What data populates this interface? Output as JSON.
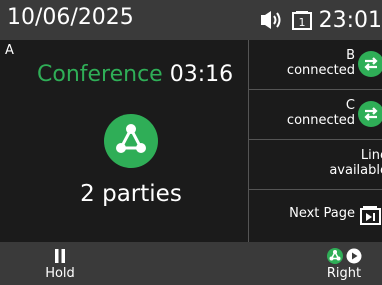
{
  "status_bar": {
    "date": "10/06/2025",
    "time": "23:01",
    "icons": [
      "speaker-icon",
      "line-indicator-icon"
    ]
  },
  "call": {
    "line_letter": "A",
    "title": "Conference",
    "timer": "03:16",
    "icon": "conference-icon",
    "parties": "2 parties"
  },
  "line_keys": [
    {
      "label": "B",
      "status": "connected",
      "icon": "transfer-arrows-icon"
    },
    {
      "label": "C",
      "status": "connected",
      "icon": "transfer-arrows-icon"
    },
    {
      "label": "Line",
      "status": "available"
    },
    {
      "label": "Next Page",
      "icon": "next-page-icon"
    }
  ],
  "softkeys": {
    "hold": "Hold",
    "right": "Right"
  },
  "colors": {
    "accent_green": "#2fae57",
    "bar_gray": "#3a3a3a",
    "background": "#1b1b1b"
  }
}
